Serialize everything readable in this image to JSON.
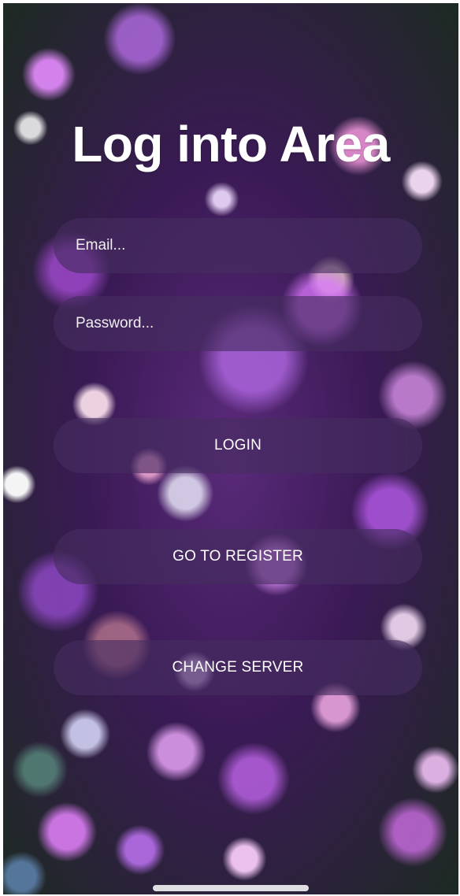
{
  "screen": {
    "title": "Log into Area"
  },
  "form": {
    "email_placeholder": "Email...",
    "password_placeholder": "Password..."
  },
  "buttons": {
    "login": "LOGIN",
    "register": "GO TO REGISTER",
    "change_server": "CHANGE SERVER"
  },
  "colors": {
    "text": "#ffffff",
    "pill_background": "#462d5f",
    "accent_background": "#5a2a7a"
  }
}
